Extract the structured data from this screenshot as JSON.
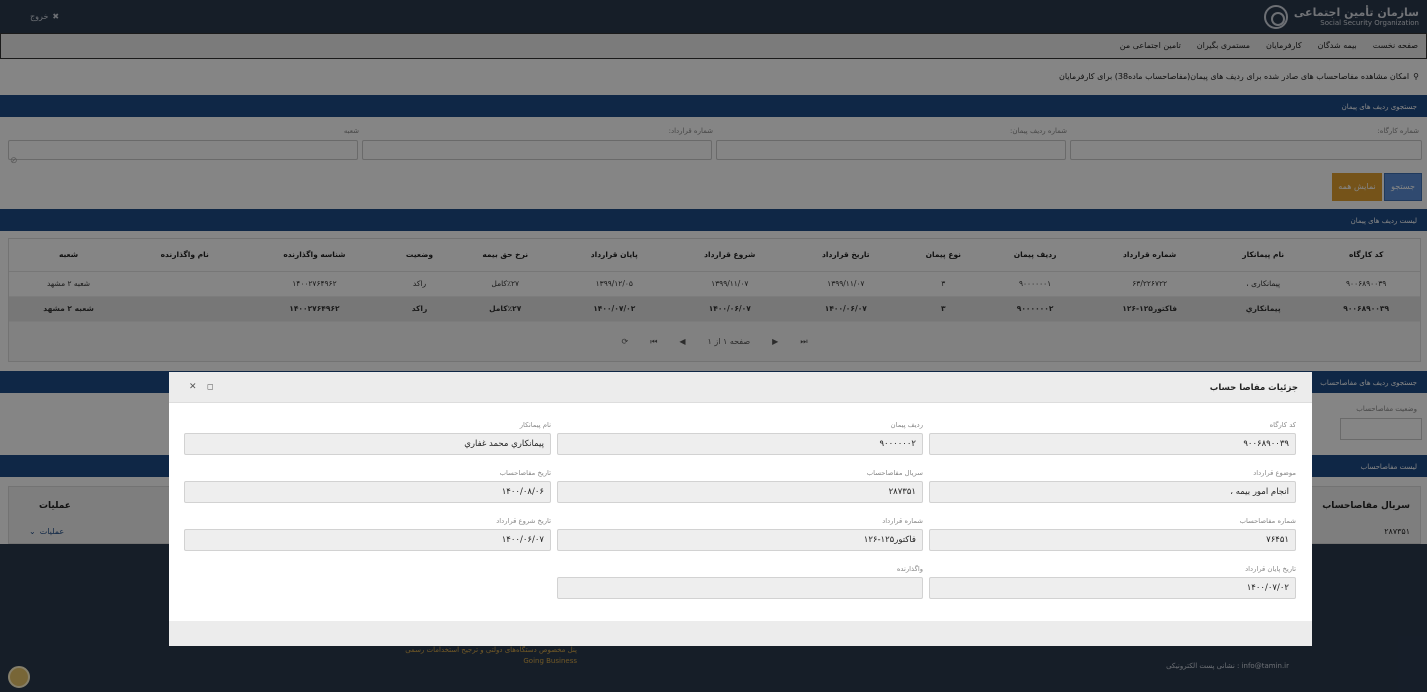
{
  "header": {
    "org_name_fa": "سازمان تأمین اجتماعی",
    "org_name_en": "Social Security Organization",
    "logout_label": "خروج"
  },
  "menu": {
    "items": [
      "صفحه نخست",
      "بیمه شدگان",
      "کارفرمایان",
      "مستمری بگیران",
      "تامین اجتماعی من"
    ]
  },
  "notice": "امکان مشاهده مفاصاحساب های صادر شده برای ردیف های پیمان(مفاصاحساب ماده38) برای کارفرمایان",
  "search_section": {
    "title": "جستجوی ردیف های پیمان",
    "fields": {
      "workshop_code_label": "شماره کارگاه:",
      "contract_row_label": "شماره ردیف پیمان:",
      "contract_no_label": "شماره قرارداد:",
      "branch_label": "شعبه"
    },
    "search_button": "جستجو",
    "show_all_button": "نمایش همه"
  },
  "contracts_list": {
    "title": "لیست ردیف های پیمان",
    "columns": [
      "کد کارگاه",
      "نام پیمانکار",
      "شماره قرارداد",
      "ردیف پیمان",
      "نوع پیمان",
      "تاریخ قرارداد",
      "شروع قرارداد",
      "پایان قرارداد",
      "نرخ حق بیمه",
      "وضعیت",
      "شناسه واگذارنده",
      "نام واگذارنده",
      "شعبه"
    ],
    "rows": [
      [
        "۹۰۰۶۸۹۰۰۳۹",
        "پیمانکاری ،",
        "۶۳/۲۲۶۷۲۲",
        "۹۰۰۰۰۰۰۱",
        "۳",
        "۱۳۹۹/۱۱/۰۷",
        "۱۳۹۹/۱۱/۰۷",
        "۱۳۹۹/۱۲/۰۵",
        "٪۲۷کامل",
        "راکد",
        "۱۴۰۰۲۷۶۴۹۶۲",
        "",
        "شعبه ۲ مشهد"
      ],
      [
        "۹۰۰۶۸۹۰۰۳۹",
        "پیمانکاري",
        "فاکتور۱۲۵-۱۲۶",
        "۹۰۰۰۰۰۰۲",
        "۳",
        "۱۴۰۰/۰۶/۰۷",
        "۱۴۰۰/۰۶/۰۷",
        "۱۴۰۰/۰۷/۰۲",
        "٪۲۷کامل",
        "راکد",
        "۱۴۰۰۲۷۶۴۹۶۲",
        "",
        "شعبه ۲ مشهد"
      ]
    ],
    "pager": {
      "page_text": "صفحه ۱ از ۱",
      "first_icon": "first-page-icon",
      "prev_icon": "prev-page-icon",
      "next_icon": "next-page-icon",
      "last_icon": "last-page-icon",
      "refresh_icon": "refresh-icon"
    }
  },
  "clearance_search": {
    "title": "جستجوی ردیف های مفاصاحساب",
    "status_label": "وضعیت مفاصاحساب"
  },
  "clearance_list": {
    "title": "لیست مفاصاحساب",
    "col_serial": "سریال مفاصاحساب",
    "col_ops": "عملیات",
    "serial_value": "۲۸۷۳۵۱",
    "ops_label": "عملیات"
  },
  "footer": {
    "line1": "پنل مخصوص دستگاه‌های دولتی و ترجیح استخدامات رسمی",
    "line2": "Going Business",
    "email": "info@tamin.ir : نشانی پست الکترونیکی"
  },
  "modal": {
    "title": "جزئیات مفاصا حساب",
    "fields": [
      {
        "label": "کد کارگاه",
        "value": "۹۰۰۶۸۹۰۰۳۹"
      },
      {
        "label": "ردیف پیمان",
        "value": "۹۰۰۰۰۰۰۲"
      },
      {
        "label": "نام پیمانکار",
        "value": "پیمانکاري محمد غفاري"
      },
      {
        "label": "موضوع قرارداد",
        "value": "انجام امور بیمه ،"
      },
      {
        "label": "سریال مفاصاحساب",
        "value": "۲۸۷۳۵۱"
      },
      {
        "label": "تاریخ مفاصاحساب",
        "value": "۱۴۰۰/۰۸/۰۶"
      },
      {
        "label": "شماره مفاصاحساب",
        "value": "۷۶۴۵۱"
      },
      {
        "label": "شماره قرارداد",
        "value": "فاکتور۱۲۵-۱۲۶"
      },
      {
        "label": "تاریخ شروع قرارداد",
        "value": "۱۴۰۰/۰۶/۰۷"
      },
      {
        "label": "تاریخ پایان قرارداد",
        "value": "۱۴۰۰/۰۷/۰۲"
      },
      {
        "label": "واگذارنده",
        "value": ""
      }
    ]
  }
}
